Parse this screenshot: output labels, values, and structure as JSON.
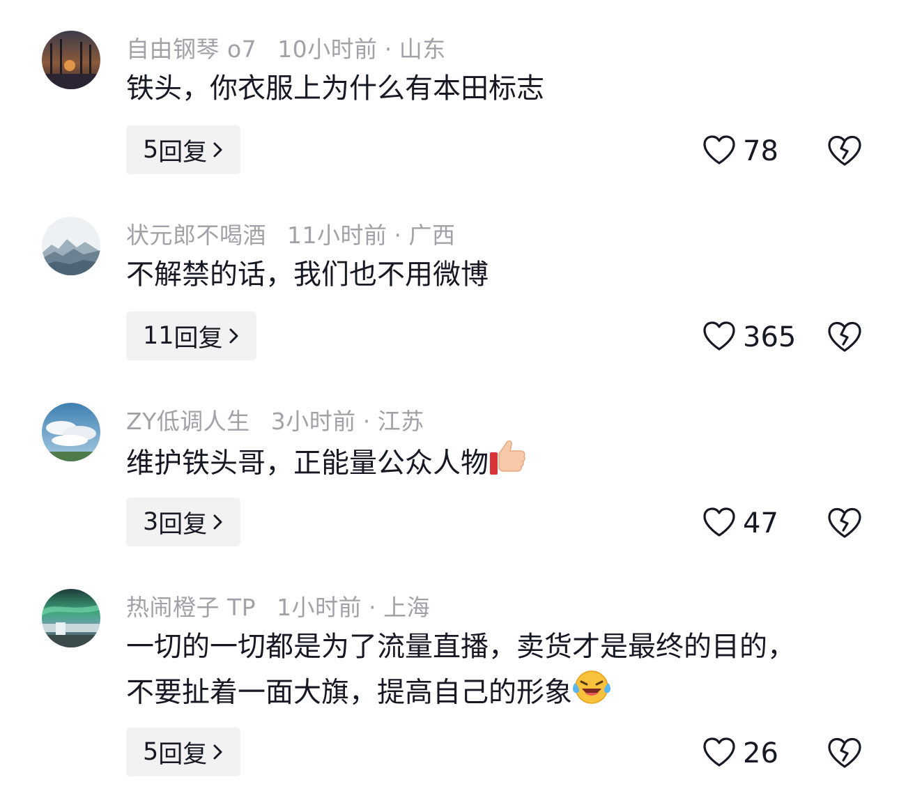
{
  "comments": [
    {
      "username": "自由钢琴 o7",
      "time": "10小时前",
      "location": "山东",
      "text": "铁头，你衣服上为什么有本田标志",
      "text2": "",
      "emoji": "",
      "reply_count": "5",
      "reply_label": "回复",
      "likes": "78",
      "avatar": "sunset-trees"
    },
    {
      "username": "状元郎不喝酒",
      "time": "11小时前",
      "location": "广西",
      "text": "不解禁的话，我们也不用微博",
      "text2": "",
      "emoji": "",
      "reply_count": "11",
      "reply_label": "回复",
      "likes": "365",
      "avatar": "misty-mountains"
    },
    {
      "username": "ZY低调人生",
      "time": "3小时前",
      "location": "江苏",
      "text": "维护铁头哥，正能量公众人物",
      "text2": "",
      "emoji": "thumbs-up",
      "reply_count": "3",
      "reply_label": "回复",
      "likes": "47",
      "avatar": "sky-clouds"
    },
    {
      "username": "热闹橙子 TP",
      "time": "1小时前",
      "location": "上海",
      "text": "一切的一切都是为了流量直播，卖货才是最终的目的，",
      "text2": "不要扯着一面大旗，提高自己的形象",
      "emoji": "laughing-crying",
      "reply_count": "5",
      "reply_label": "回复",
      "likes": "26",
      "avatar": "aurora-waterfall"
    }
  ],
  "separator_dot": "·"
}
